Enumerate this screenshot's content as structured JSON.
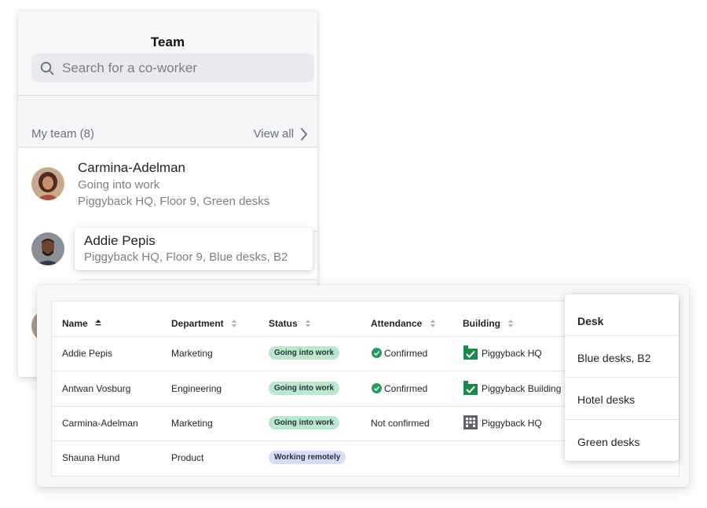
{
  "team_panel": {
    "title": "Team",
    "search_placeholder": "Search for a co-worker",
    "section_label": "My team (8)",
    "view_all": "View all",
    "members": [
      {
        "name": "Carmina-Adelman",
        "status": "Going into work",
        "location": "Piggyback HQ, Floor 9, Green desks"
      },
      {
        "name": "Addie Pepis",
        "location": "Piggyback HQ, Floor 9, Blue desks, B2"
      }
    ]
  },
  "table": {
    "columns": [
      "Name",
      "Department",
      "Status",
      "Attendance",
      "Building"
    ],
    "rows": [
      {
        "name": "Addie Pepis",
        "department": "Marketing",
        "status": "Going into work",
        "status_color": "#b9e8cf",
        "attendance": "Confirmed",
        "attendance_icon": "check-circle-icon",
        "building": "Piggyback HQ",
        "building_icon": "checked-building-icon"
      },
      {
        "name": "Antwan Vosburg",
        "department": "Engineering",
        "status": "Going into work",
        "status_color": "#b9e8cf",
        "attendance": "Confirmed",
        "attendance_icon": "check-circle-icon",
        "building": "Piggyback Building",
        "building_icon": "checked-building-icon"
      },
      {
        "name": "Carmina-Adelman",
        "department": "Marketing",
        "status": "Going into work",
        "status_color": "#b9e8cf",
        "attendance": "Not confirmed",
        "attendance_icon": "",
        "building": "Piggyback HQ",
        "building_icon": "building-grid-icon"
      },
      {
        "name": "Shauna Hund",
        "department": "Product",
        "status": "Working remotely",
        "status_color": "#d6defb",
        "attendance": "",
        "attendance_icon": "",
        "building": "",
        "building_icon": ""
      }
    ]
  },
  "desk_dropdown": {
    "title": "Desk",
    "options": [
      "Blue desks, B2",
      "Hotel desks",
      "Green desks"
    ]
  },
  "colors": {
    "confirmed_green": "#1e9e5a",
    "building_green": "#1a8a4a",
    "muted_text": "#7b7f86"
  }
}
